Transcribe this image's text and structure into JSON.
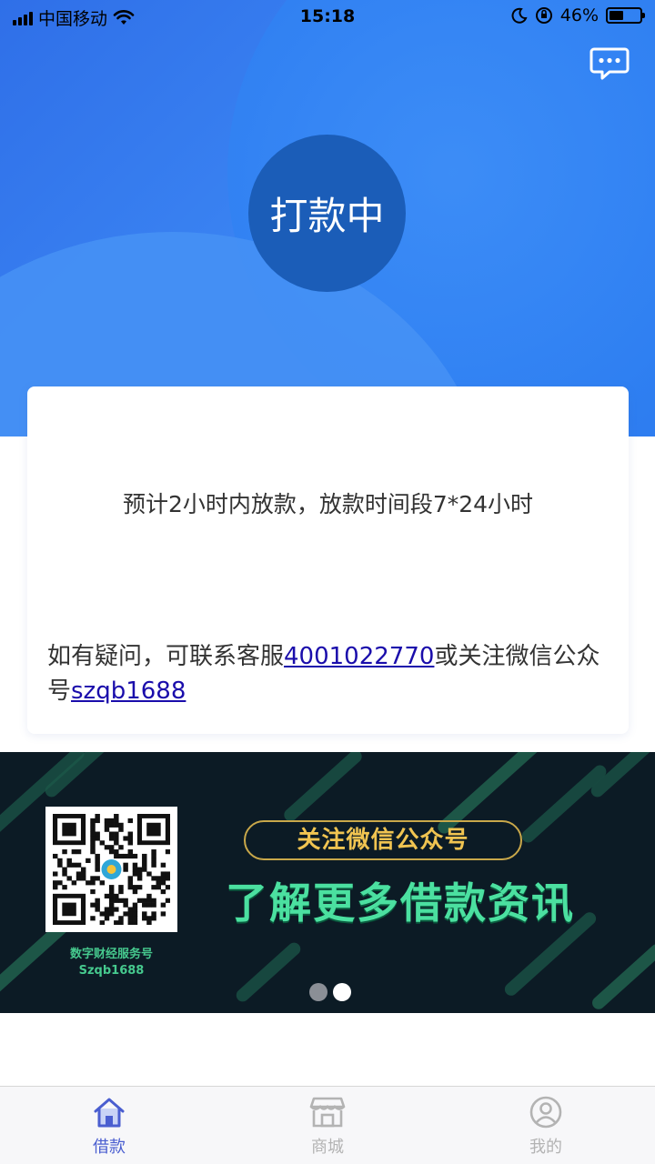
{
  "status_bar": {
    "carrier": "中国移动",
    "time": "15:18",
    "battery": "46%",
    "battery_level": 0.46
  },
  "header": {
    "message_icon": "chat-bubble-icon",
    "status_label": "打款中"
  },
  "card": {
    "eta_text": "预计2小时内放款，放款时间段7*24小时",
    "help_prefix": "如有疑问，可联系客服",
    "phone": "4001022770",
    "help_middle": "或关注微信公众号",
    "wechat_id": "szqb1688"
  },
  "banner": {
    "pill_text": "关注微信公众号",
    "headline": "了解更多借款资讯",
    "qr_caption_line1": "数字财经服务号",
    "qr_caption_line2": "Szqb1688",
    "slide_count": 2,
    "active_slide": 2
  },
  "tabs": [
    {
      "label": "借款",
      "icon": "home-icon",
      "active": true
    },
    {
      "label": "商城",
      "icon": "store-icon",
      "active": false
    },
    {
      "label": "我的",
      "icon": "profile-icon",
      "active": false
    }
  ],
  "colors": {
    "primary_blue": "#2f7df0",
    "status_circle": "#1b5db8",
    "tab_active": "#4a5ed0",
    "banner_bg": "#0c1b25",
    "banner_green": "#4be0a0",
    "banner_gold": "#f0c451"
  }
}
